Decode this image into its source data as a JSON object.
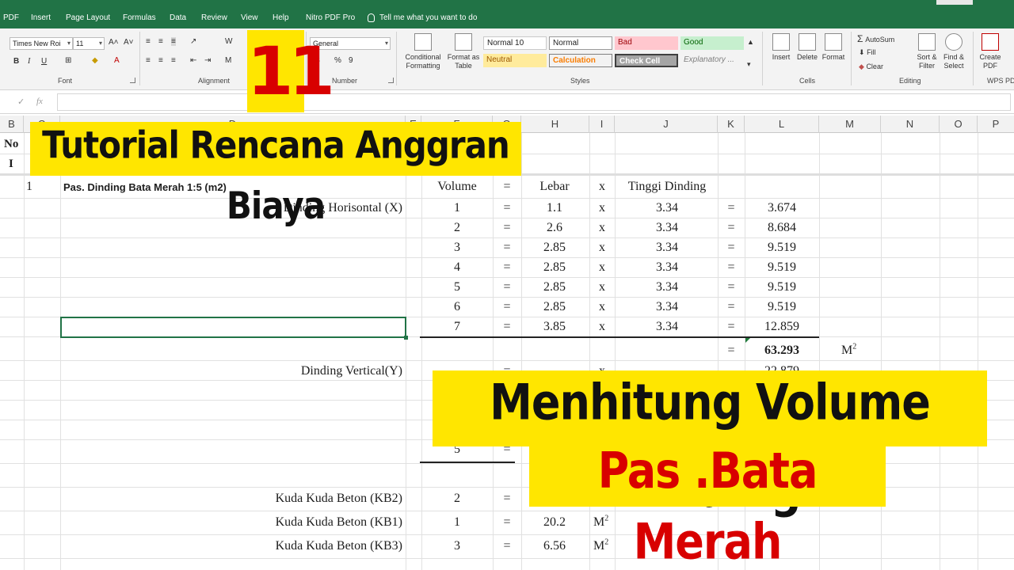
{
  "ribbon_tabs": [
    "PDF",
    "Insert",
    "Page Layout",
    "Formulas",
    "Data",
    "Review",
    "View",
    "Help",
    "Nitro PDF Pro"
  ],
  "tell_me": "Tell me what you want to do",
  "font": {
    "name": "Times New Roi",
    "size": "11",
    "grow": "A˄",
    "shrink": "A˅",
    "bold": "B",
    "italic": "I",
    "underline": "U",
    "label": "Font"
  },
  "alignment": {
    "wrap": "W",
    "merge": "M",
    "label": "Alignment"
  },
  "number": {
    "format": "General",
    "currency": "$",
    "percent": "%",
    "comma": "9",
    "label": "Number"
  },
  "styles": {
    "conditional": "Conditional Formatting",
    "format_as_table": "Format as Table",
    "normal10": "Normal 10",
    "normal": "Normal",
    "bad": "Bad",
    "good": "Good",
    "neutral": "Neutral",
    "calculation": "Calculation",
    "check_cell": "Check Cell",
    "explanatory": "Explanatory ...",
    "label": "Styles",
    "colors": {
      "bad_bg": "#ffc7ce",
      "bad_fg": "#9c0006",
      "good_bg": "#c6efce",
      "good_fg": "#006100",
      "neutral_bg": "#ffeb9c",
      "neutral_fg": "#9c5700",
      "calc_fg": "#fa7d00",
      "check_bg": "#a5a5a5"
    }
  },
  "cells_group": {
    "insert": "Insert",
    "delete": "Delete",
    "format": "Format",
    "label": "Cells"
  },
  "editing": {
    "autosum": "AutoSum",
    "fill": "Fill",
    "clear": "Clear",
    "sort": "Sort & Filter",
    "find": "Find & Select",
    "label": "Editing"
  },
  "pdf": {
    "create": "Create PDF",
    "label": "WPS PD"
  },
  "formula_bar": {
    "cancel": "✓",
    "fx": "fx"
  },
  "columns": [
    "B",
    "C",
    "D",
    "E",
    "F",
    "G",
    "H",
    "I",
    "J",
    "K",
    "L",
    "M",
    "N",
    "O",
    "P"
  ],
  "header": {
    "no": "No",
    "roman": "I"
  },
  "item": {
    "number": "1",
    "title": "Pas. Dinding Bata Merah  1:5 (m2)"
  },
  "labels": {
    "volume": "Volume",
    "equals": "=",
    "lebar": "Lebar",
    "times": "x",
    "tinggi": "Tinggi Dinding"
  },
  "horizontal": {
    "label": "Dinding Horisontal (X)",
    "rows": [
      {
        "n": "1",
        "lebar": "1.1",
        "tinggi": "3.34",
        "result": "3.674"
      },
      {
        "n": "2",
        "lebar": "2.6",
        "tinggi": "3.34",
        "result": "8.684"
      },
      {
        "n": "3",
        "lebar": "2.85",
        "tinggi": "3.34",
        "result": "9.519"
      },
      {
        "n": "4",
        "lebar": "2.85",
        "tinggi": "3.34",
        "result": "9.519"
      },
      {
        "n": "5",
        "lebar": "2.85",
        "tinggi": "3.34",
        "result": "9.519"
      },
      {
        "n": "6",
        "lebar": "2.85",
        "tinggi": "3.34",
        "result": "9.519"
      },
      {
        "n": "7",
        "lebar": "3.85",
        "tinggi": "3.34",
        "result": "12.859"
      }
    ],
    "total": "63.293",
    "unit": "M"
  },
  "vertical": {
    "label": "Dinding Vertical(Y)",
    "first_result": "22.879",
    "last_n": "5"
  },
  "kuda": [
    {
      "label": "Kuda Kuda Beton (KB2)",
      "n": "2",
      "value": "",
      "unit": ""
    },
    {
      "label": "Kuda Kuda Beton (KB1)",
      "n": "1",
      "value": "20.2",
      "unit": "M"
    },
    {
      "label": "Kuda Kuda Beton (KB3)",
      "n": "3",
      "value": "6.56",
      "unit": "M"
    }
  ],
  "overlay": {
    "episode": "11",
    "title": "Tutorial Rencana Anggran Biaya",
    "subtitle1": "Menhitung Volume Dinding",
    "subtitle2": "Pas .Bata Merah",
    "colors": {
      "yellow": "#ffe600",
      "red": "#d80000"
    }
  }
}
